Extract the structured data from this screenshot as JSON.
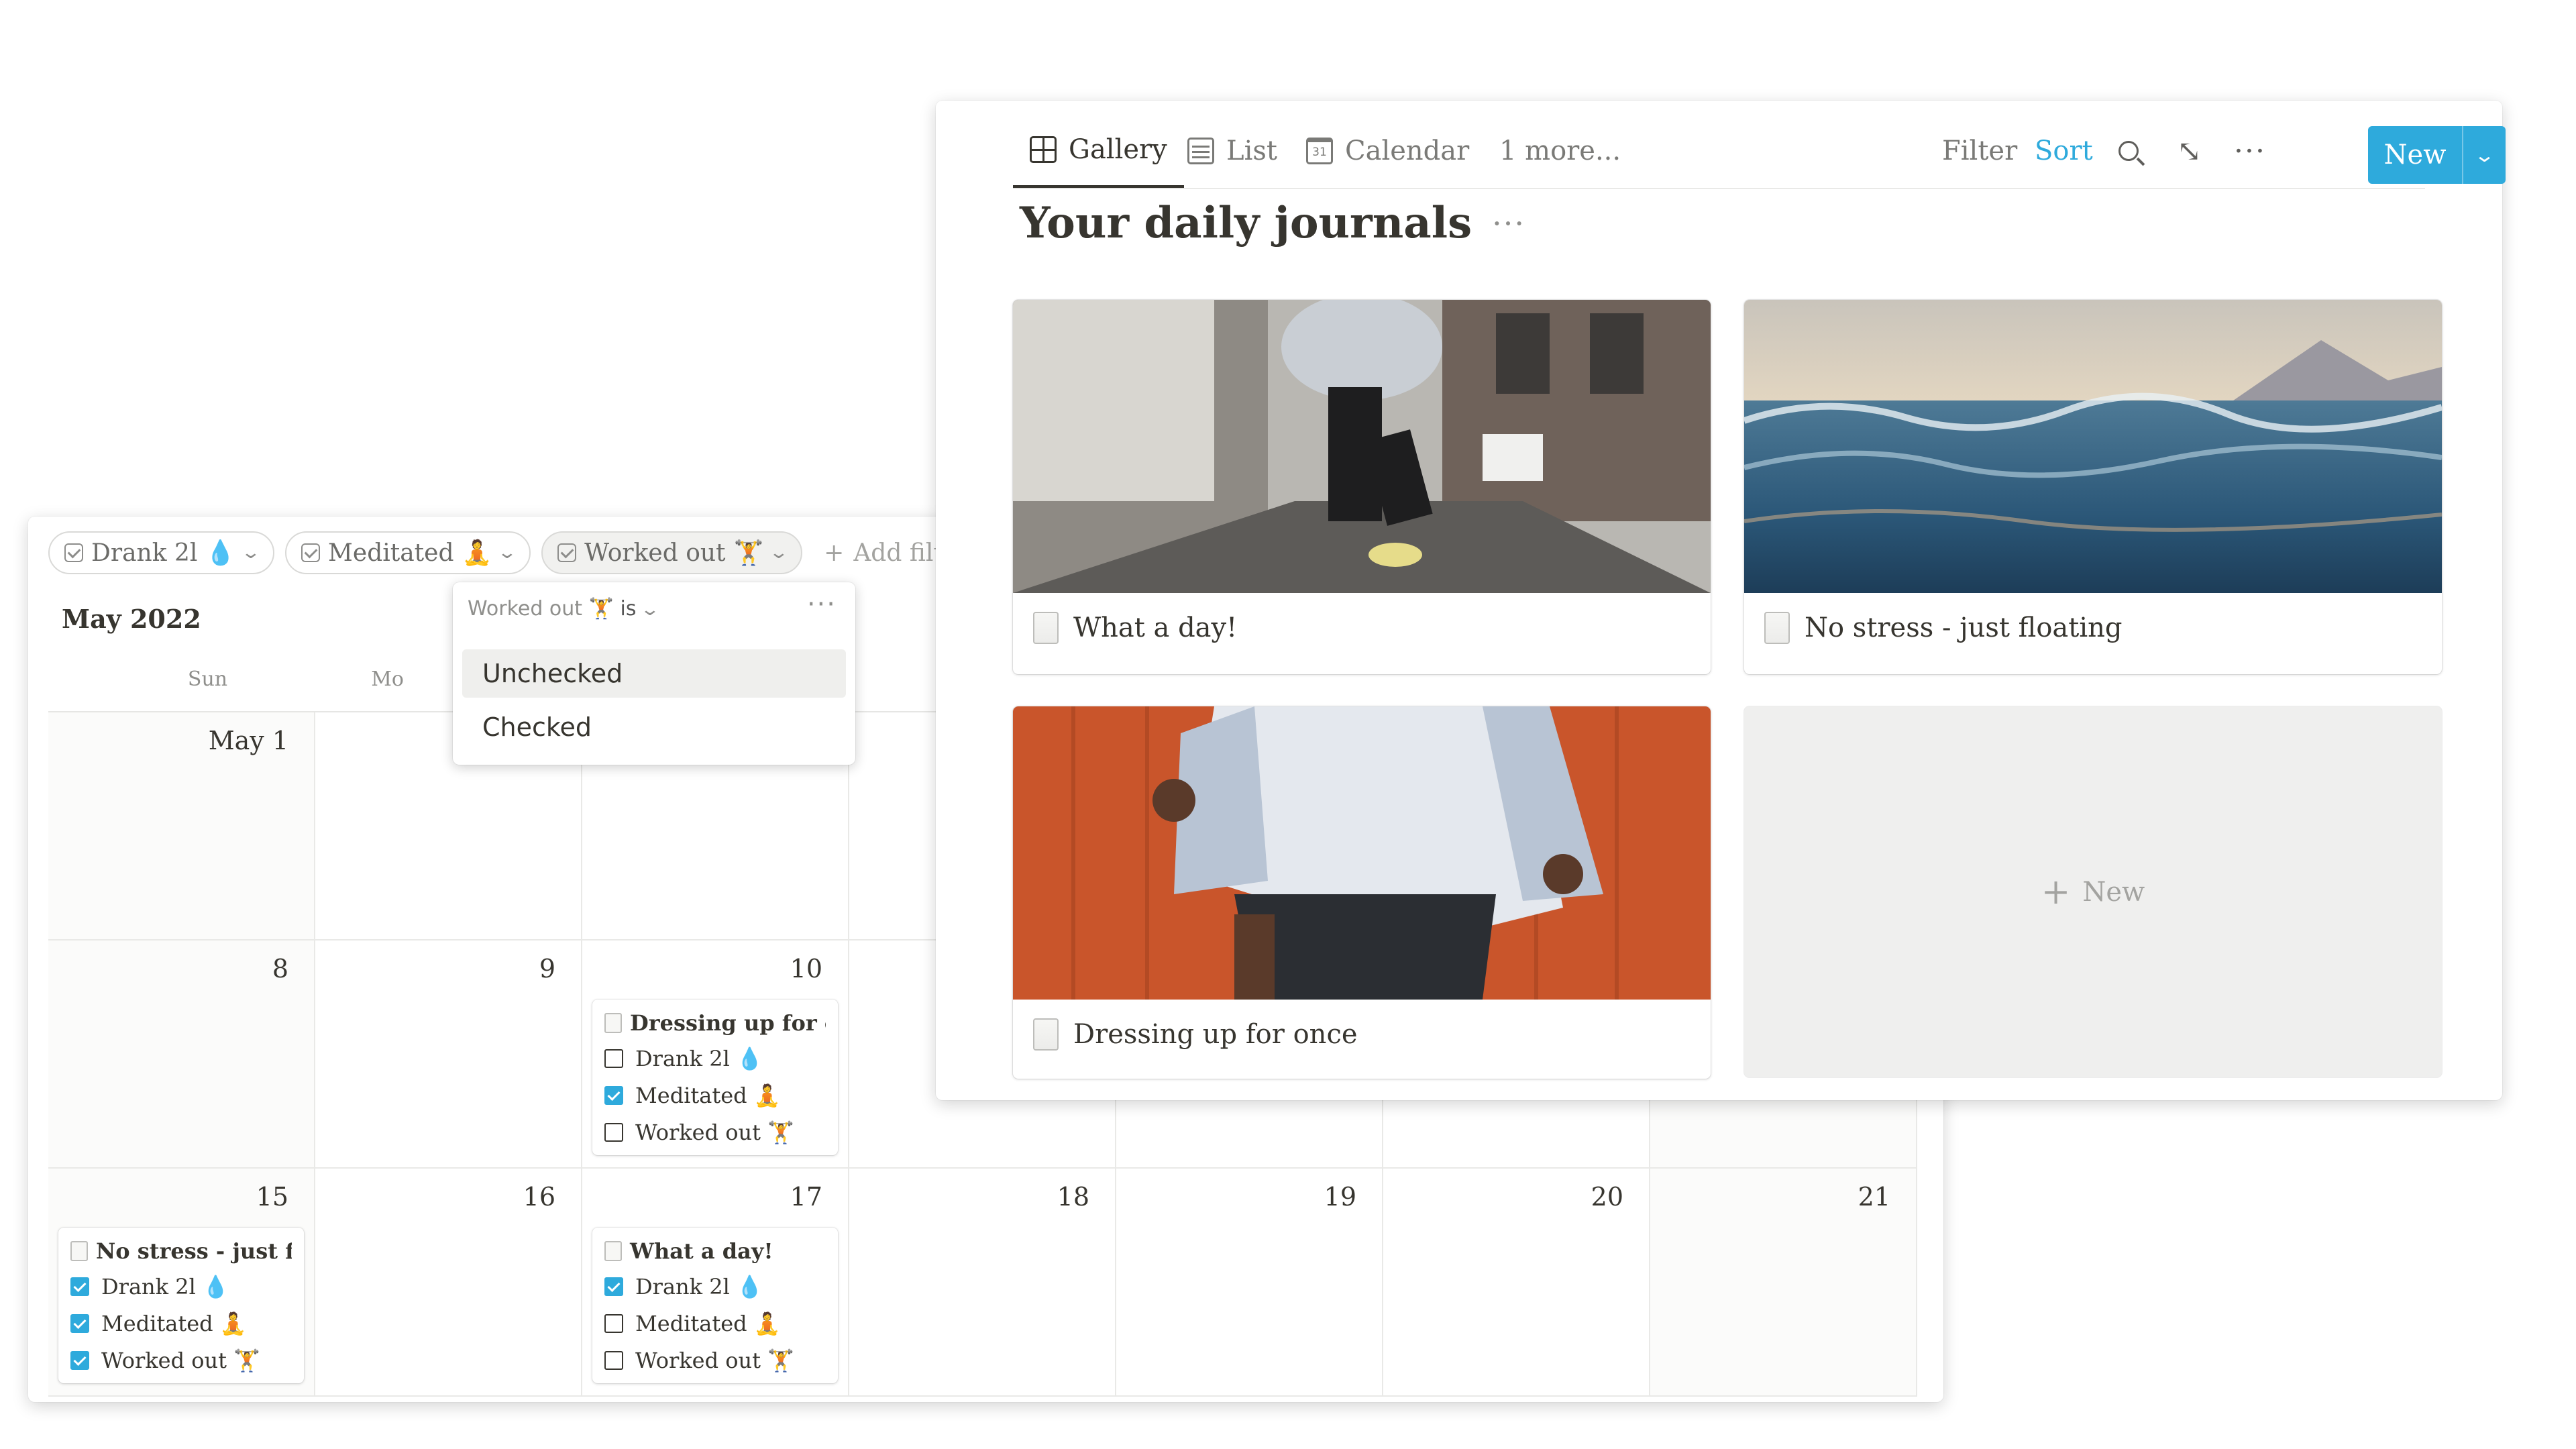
{
  "calendar": {
    "filters": [
      {
        "label": "Drank 2l",
        "emoji": "💧"
      },
      {
        "label": "Meditated",
        "emoji": "🧘"
      },
      {
        "label": "Worked out",
        "emoji": "🏋"
      }
    ],
    "add_filter_label": "Add filte",
    "month_label": "May 2022",
    "weekday_headers": [
      "Sun",
      "Mo"
    ],
    "days": {
      "d1": "May 1",
      "d8": "8",
      "d9": "9",
      "d10": "10",
      "d15": "15",
      "d16": "16",
      "d17": "17",
      "d18": "18",
      "d19": "19",
      "d20": "20",
      "d21": "21"
    },
    "entries": [
      {
        "title": "Dressing up for o...",
        "props": [
          {
            "label": "Drank 2l",
            "emoji": "💧",
            "checked": false
          },
          {
            "label": "Meditated",
            "emoji": "🧘",
            "checked": true
          },
          {
            "label": "Worked out",
            "emoji": "🏋",
            "checked": false
          }
        ]
      },
      {
        "title": "No stress - just fl...",
        "props": [
          {
            "label": "Drank 2l",
            "emoji": "💧",
            "checked": true
          },
          {
            "label": "Meditated",
            "emoji": "🧘",
            "checked": true
          },
          {
            "label": "Worked out",
            "emoji": "🏋",
            "checked": true
          }
        ]
      },
      {
        "title": "What a day!",
        "props": [
          {
            "label": "Drank 2l",
            "emoji": "💧",
            "checked": true
          },
          {
            "label": "Meditated",
            "emoji": "🧘",
            "checked": false
          },
          {
            "label": "Worked out",
            "emoji": "🏋",
            "checked": false
          }
        ]
      }
    ]
  },
  "filter_dropdown": {
    "property": "Worked out",
    "property_emoji": "🏋",
    "operator": "is",
    "options": [
      "Unchecked",
      "Checked"
    ],
    "highlighted": "Unchecked"
  },
  "gallery": {
    "tabs": [
      {
        "label": "Gallery",
        "icon": "gallery-icon",
        "active": true
      },
      {
        "label": "List",
        "icon": "table-icon",
        "active": false
      },
      {
        "label": "Calendar",
        "icon": "calendar-icon",
        "active": false
      },
      {
        "label": "1 more...",
        "active": false
      }
    ],
    "calendar_icon_text": "31",
    "toolbar": {
      "filter": "Filter",
      "sort": "Sort",
      "new": "New"
    },
    "title": "Your daily journals",
    "cards": [
      {
        "title": "What a day!",
        "image": "street-dancer-photo"
      },
      {
        "title": "No stress - just floating",
        "image": "ocean-waves-photo"
      },
      {
        "title": "Dressing up for once",
        "image": "orange-wall-dancer-photo"
      }
    ],
    "new_card_label": "New"
  },
  "colors": {
    "accent": "#2eaadc",
    "text": "#37352f",
    "muted": "#8f8f8c"
  }
}
